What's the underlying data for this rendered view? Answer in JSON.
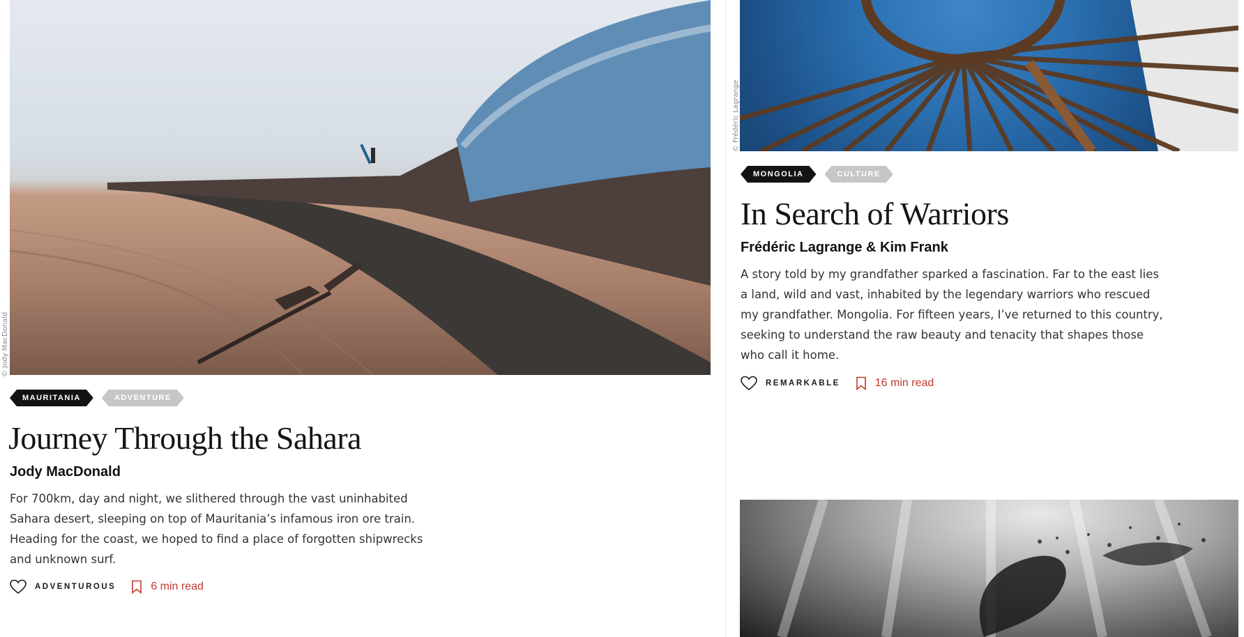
{
  "colors": {
    "tag_dark": "#131313",
    "tag_light": "#c6c6c6",
    "accent_red": "#c0392b",
    "divider": "#e6e6e6"
  },
  "left_story": {
    "photo_credit": "© Jody MacDonald",
    "tags": [
      "MAURITANIA",
      "ADVENTURE"
    ],
    "title": "Journey Through the Sahara",
    "author": "Jody MacDonald",
    "excerpt": "For 700km, day and night, we slithered through the vast uninhabited Sahara desert, sleeping on top of Mauritania’s infamous iron ore train. Heading for the coast, we hoped to find a place of forgotten shipwrecks and unknown surf.",
    "mood": "ADVENTUROUS",
    "read_time": "6 min read",
    "icons": {
      "like": "heart-icon",
      "save": "bookmark-icon"
    }
  },
  "right_story": {
    "photo_credit": "© Frédéric Lagrange",
    "tags": [
      "MONGOLIA",
      "CULTURE"
    ],
    "title": "In Search of Warriors",
    "author": "Frédéric Lagrange & Kim Frank",
    "excerpt": "A story told by my grandfather sparked a fascination. Far to the east lies a land, wild and vast, inhabited by the legendary warriors who rescued my grandfather. Mongolia. For fifteen years, I’ve returned to this country, seeking to understand the raw beauty and tenacity that shapes those who call it home.",
    "mood": "REMARKABLE",
    "read_time": "16 min read",
    "icons": {
      "like": "heart-icon",
      "save": "bookmark-icon"
    }
  }
}
